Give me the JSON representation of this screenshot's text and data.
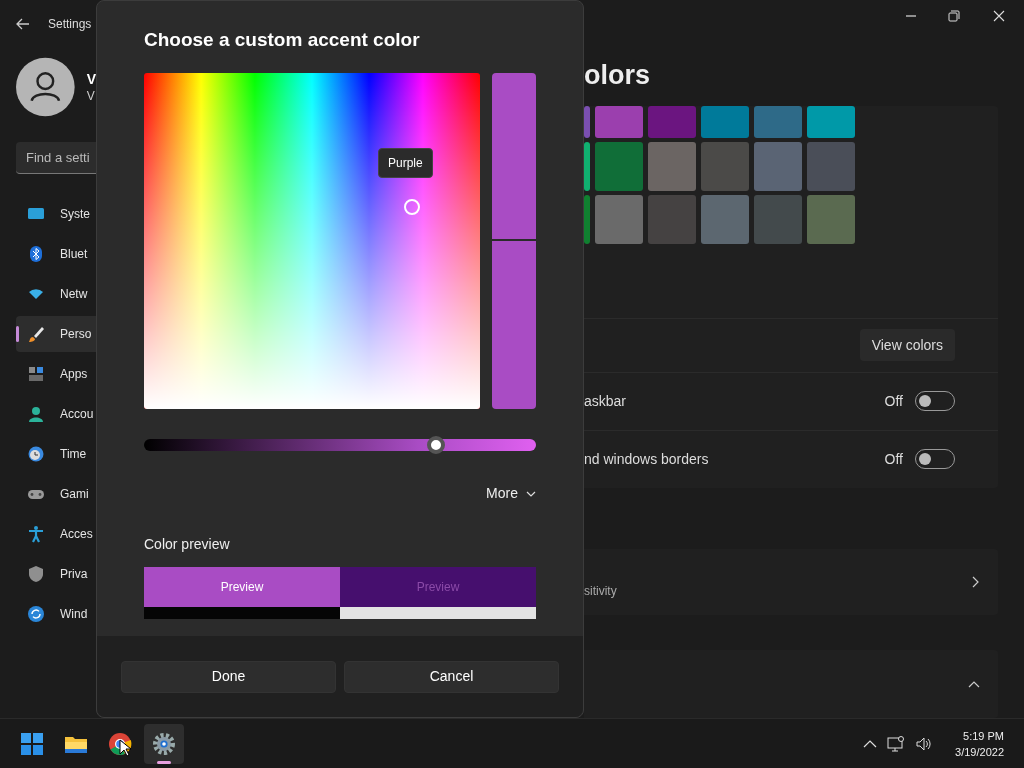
{
  "window": {
    "title": "Settings"
  },
  "profile": {
    "name": "V",
    "email": "V"
  },
  "search": {
    "placeholder": "Find a setti"
  },
  "sidebar": {
    "items": [
      {
        "label": "Syste",
        "kind": "system",
        "selected": false
      },
      {
        "label": "Bluet",
        "kind": "bluetooth",
        "selected": false
      },
      {
        "label": "Netw",
        "kind": "network",
        "selected": false
      },
      {
        "label": "Perso",
        "kind": "personalization",
        "selected": true
      },
      {
        "label": "Apps",
        "kind": "apps",
        "selected": false
      },
      {
        "label": "Accou",
        "kind": "accounts",
        "selected": false
      },
      {
        "label": "Time",
        "kind": "time",
        "selected": false
      },
      {
        "label": "Gami",
        "kind": "gaming",
        "selected": false
      },
      {
        "label": "Acces",
        "kind": "accessibility",
        "selected": false
      },
      {
        "label": "Priva",
        "kind": "privacy",
        "selected": false
      },
      {
        "label": "Wind",
        "kind": "update",
        "selected": false
      }
    ]
  },
  "page": {
    "title": "olors",
    "swatches": [
      {
        "color": "#7a4fb0"
      },
      {
        "color": "#9b3fae"
      },
      {
        "color": "#6b1580"
      },
      {
        "color": "#007a9a"
      },
      {
        "color": "#2e6a88"
      },
      {
        "color": "#0099a8"
      },
      {
        "color": "#10b070"
      },
      {
        "color": "#106e38"
      },
      {
        "color": "#6b6563"
      },
      {
        "color": "#4b4a48"
      },
      {
        "color": "#5a6474"
      },
      {
        "color": "#4a4e58"
      },
      {
        "color": "#108030"
      },
      {
        "color": "#6a6a6a"
      },
      {
        "color": "#454242"
      },
      {
        "color": "#5c6770"
      },
      {
        "color": "#434a4c"
      },
      {
        "color": "#5a6a50"
      }
    ],
    "rows": [
      {
        "kind": "button",
        "button": "View colors"
      },
      {
        "kind": "toggle",
        "label": "askbar",
        "state": "Off",
        "on": false
      },
      {
        "kind": "toggle",
        "label": "nd windows borders",
        "state": "Off",
        "on": false
      }
    ],
    "cards": [
      {
        "kind": "link",
        "label": "sitivity"
      },
      {
        "kind": "expander",
        "expanded": true
      }
    ]
  },
  "dialog": {
    "title": "Choose a custom accent color",
    "tooltip": "Purple",
    "slider": {
      "level": 0.745
    },
    "more": "More",
    "preview_label": "Color preview",
    "previews": [
      {
        "label": "Preview",
        "kind": "on_dark",
        "color": "#a94cc4"
      },
      {
        "label": "Preview",
        "kind": "on_light",
        "color": "#460f6e"
      }
    ],
    "buttons": [
      "Done",
      "Cancel"
    ]
  },
  "taskbar": {
    "apps": [
      {
        "kind": "start",
        "selected": false
      },
      {
        "kind": "files",
        "selected": false
      },
      {
        "kind": "browser",
        "selected": false
      },
      {
        "kind": "settings",
        "selected": true
      }
    ],
    "time": "5:19 PM",
    "date": "3/19/2022"
  }
}
